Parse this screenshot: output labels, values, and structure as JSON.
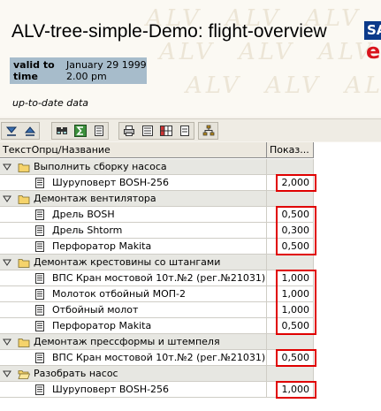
{
  "header": {
    "title": "ALV-tree-simple-Demo: flight-overview",
    "watermark": "ALV",
    "valid_to_label": "valid to",
    "valid_to_value": "January 29 1999",
    "time_label": "time",
    "time_value": "2.00 pm",
    "uptodate": "up-to-date data",
    "logo_text": "SAP",
    "logo_letter": "e"
  },
  "toolbar": {
    "groups": [
      [
        "expand-icon",
        "collapse-icon"
      ],
      [
        "find-icon",
        "sum-icon",
        "subtotal-icon"
      ],
      [
        "print-icon",
        "details-icon",
        "layout-icon",
        "export-icon"
      ],
      [
        "hierarchy-icon"
      ]
    ]
  },
  "grid": {
    "columns": [
      "ТекстОпрц/Название",
      "Показ..."
    ],
    "rows": [
      {
        "type": "group",
        "text": "Выполнить сборку насоса",
        "value": ""
      },
      {
        "type": "item",
        "text": "Шуруповерт BOSH-256",
        "value": "2,000"
      },
      {
        "type": "group",
        "text": "Демонтаж вентилятора",
        "value": ""
      },
      {
        "type": "item",
        "text": "Дрель BOSH",
        "value": "0,500"
      },
      {
        "type": "item",
        "text": "Дрель Shtorm",
        "value": "0,300"
      },
      {
        "type": "item",
        "text": "Перфоратор Makita",
        "value": "0,500"
      },
      {
        "type": "group",
        "text": "Демонтаж крестовины со штангами",
        "value": ""
      },
      {
        "type": "item",
        "text": "ВПС Кран мостовой 10т.№2 (рег.№21031)",
        "value": "1,000"
      },
      {
        "type": "item",
        "text": "Молоток отбойный МОП-2",
        "value": "1,000"
      },
      {
        "type": "item",
        "text": "Отбойный молот",
        "value": "1,000"
      },
      {
        "type": "item",
        "text": "Перфоратор Makita",
        "value": "0,500"
      },
      {
        "type": "group",
        "text": "Демонтаж прессформы и штемпеля",
        "value": ""
      },
      {
        "type": "item",
        "text": "ВПС Кран мостовой 10т.№2 (рег.№21031)",
        "value": "0,500"
      },
      {
        "type": "group",
        "text": "Разобрать насос",
        "value": ""
      },
      {
        "type": "item",
        "text": "Шуруповерт BOSH-256",
        "value": "1,000"
      }
    ]
  },
  "colors": {
    "highlight": "#e00000",
    "info_bg": "#a7bccb",
    "group_row_bg": "#e7e7e2"
  }
}
